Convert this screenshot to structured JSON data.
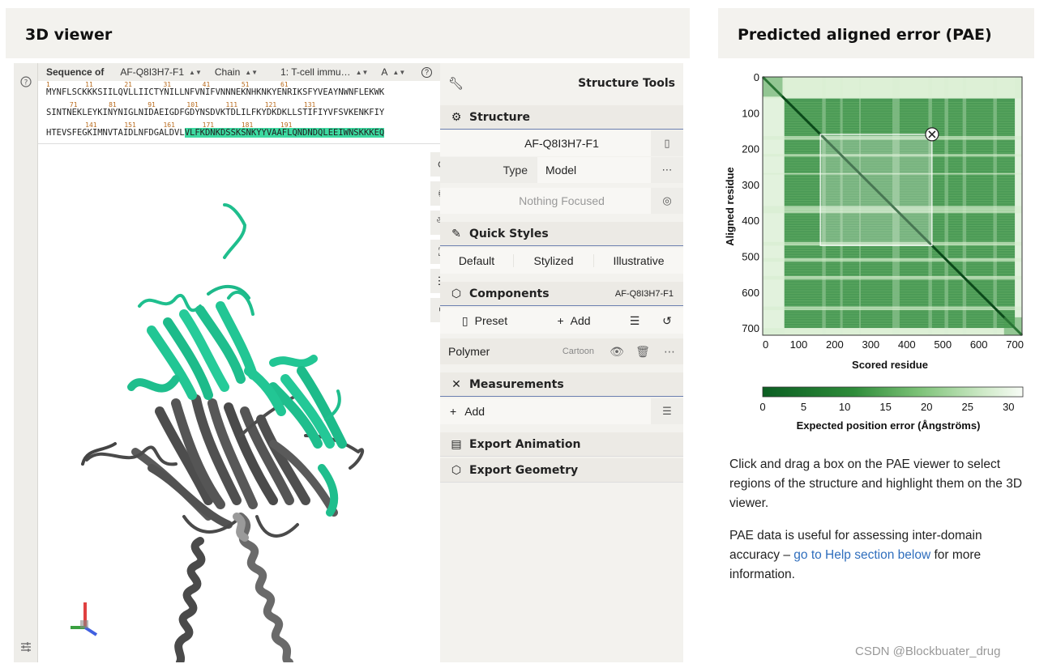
{
  "viewer_panel": {
    "title": "3D viewer"
  },
  "pae_panel": {
    "title": "Predicted aligned error (PAE)"
  },
  "sequence": {
    "label": "Sequence of",
    "entry": "AF-Q8I3H7-F1",
    "chain_label": "Chain",
    "entity": "1: T-cell immu…",
    "chain": "A",
    "rows": [
      {
        "nums": "1         11        21        31        41        51        61",
        "text": "MYNFLSCKKKSIILQVLLIICTYNILLNFVNIFVNNNEKNHKNKYENRIKSFYVEAYNWNFLEKWK",
        "hl_start": -1,
        "hl_end": -1
      },
      {
        "nums": "      71        81        91        101       111       121       131",
        "text": "SINTNEKLEYKINYNIGLNIDAEIGDFGDYNSDVKTDLILFKYDKDKLLSTIFIYVFSVKENKFIY",
        "hl_start": -1,
        "hl_end": -1
      },
      {
        "nums": "          141       151       161       171       181       191",
        "text": "HTEVSFEGKIMNVTAIDLNFDGALDVLVLFKDNKDSSKSNKYYVAAFLQNDNDQLEEIWNSKKKEQ",
        "hl_start": 27,
        "hl_end": 66
      }
    ]
  },
  "tools": {
    "structure_tools": "Structure Tools",
    "structure": "Structure",
    "structure_name": "AF-Q8I3H7-F1",
    "type_label": "Type",
    "type_value": "Model",
    "focus": "Nothing Focused",
    "quick_styles": "Quick Styles",
    "styles": [
      "Default",
      "Stylized",
      "Illustrative"
    ],
    "components": "Components",
    "components_ref": "AF-Q8I3H7-F1",
    "preset": "Preset",
    "add": "Add",
    "polymer": "Polymer",
    "polymer_repr": "Cartoon",
    "measurements": "Measurements",
    "measure_add": "Add",
    "export_animation": "Export Animation",
    "export_geometry": "Export Geometry"
  },
  "pae": {
    "ylabel": "Aligned residue",
    "xlabel": "Scored residue",
    "ticks": [
      "0",
      "100",
      "200",
      "300",
      "400",
      "500",
      "600",
      "700"
    ],
    "colorbar_ticks": [
      "0",
      "5",
      "10",
      "15",
      "20",
      "25",
      "30"
    ],
    "colorbar_label": "Expected position error (Ångströms)",
    "selection_residues": [
      160,
      470
    ],
    "colors": {
      "low": "#0b5e22",
      "mid": "#4fae55",
      "high": "#f4fbef"
    }
  },
  "description": {
    "p1": "Click and drag a box on the PAE viewer to select regions of the structure and highlight them on the 3D viewer.",
    "p2_before": "PAE data is useful for assessing inter-domain accuracy – ",
    "p2_link": "go to Help section below",
    "p2_after": " for more information."
  },
  "watermark": "CSDN @Blockbuater_drug"
}
